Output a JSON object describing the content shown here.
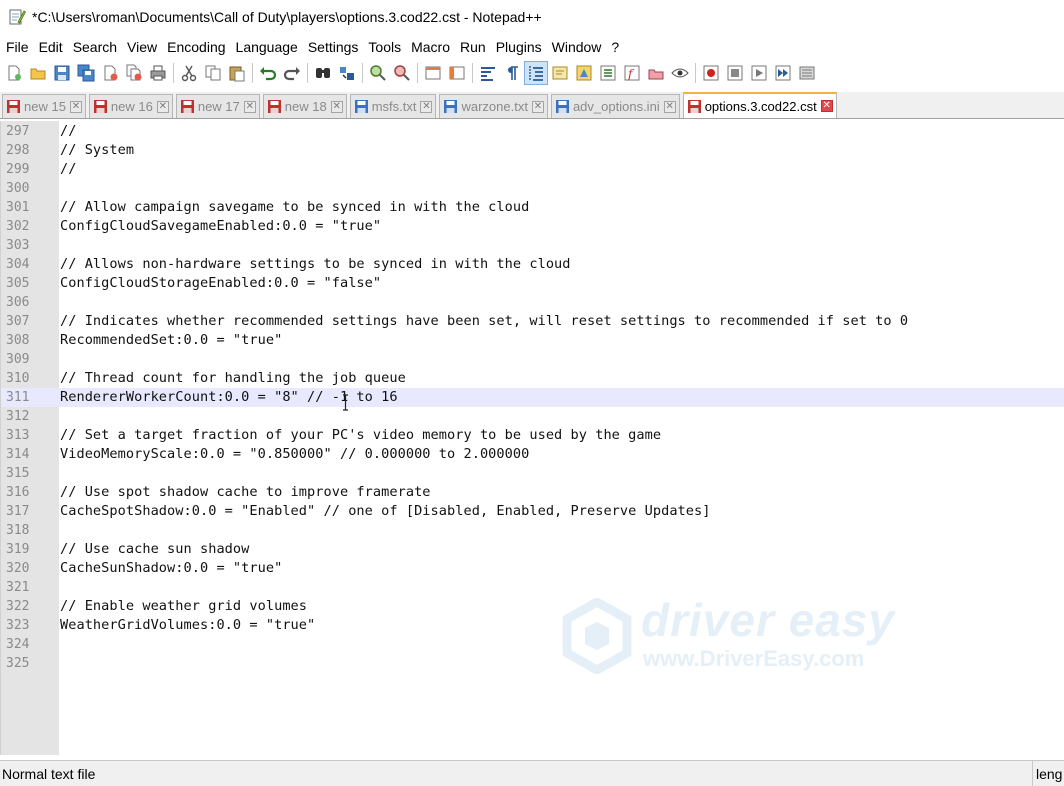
{
  "window": {
    "title": "*C:\\Users\\roman\\Documents\\Call of Duty\\players\\options.3.cod22.cst - Notepad++",
    "app_icon": "notepadpp-icon"
  },
  "menu": [
    "File",
    "Edit",
    "Search",
    "View",
    "Encoding",
    "Language",
    "Settings",
    "Tools",
    "Macro",
    "Run",
    "Plugins",
    "Window",
    "?"
  ],
  "toolbar": {
    "icons": [
      "new-file-icon",
      "open-file-icon",
      "save-icon",
      "save-all-icon",
      "close-icon",
      "close-all-icon",
      "print-icon",
      "cut-icon",
      "copy-icon",
      "paste-icon",
      "undo-icon",
      "redo-icon",
      "find-icon",
      "replace-icon",
      "zoom-in-icon",
      "zoom-out-icon",
      "sync-vertical-icon",
      "sync-horizontal-icon",
      "word-wrap-icon",
      "show-all-characters-icon",
      "indent-guide-icon",
      "user-defined-language-icon",
      "document-map-icon",
      "function-list-icon",
      "folder-as-workspace-icon",
      "monitoring-icon",
      "record-macro-icon",
      "stop-record-icon",
      "play-macro-icon",
      "run-macro-multiple-icon",
      "save-macro-icon"
    ],
    "active": "indent-guide-icon"
  },
  "tabs": [
    {
      "label": "new 15",
      "active": false,
      "saved": false
    },
    {
      "label": "new 16",
      "active": false,
      "saved": false
    },
    {
      "label": "new 17",
      "active": false,
      "saved": false
    },
    {
      "label": "new 18",
      "active": false,
      "saved": false
    },
    {
      "label": "msfs.txt",
      "active": false,
      "saved": true
    },
    {
      "label": "warzone.txt",
      "active": false,
      "saved": true
    },
    {
      "label": "adv_options.ini",
      "active": false,
      "saved": true
    },
    {
      "label": "options.3.cod22.cst",
      "active": true,
      "saved": false
    }
  ],
  "editor": {
    "current_line": 311,
    "lines": [
      {
        "n": "297",
        "text": "//"
      },
      {
        "n": "298",
        "text": "// System"
      },
      {
        "n": "299",
        "text": "//"
      },
      {
        "n": "300",
        "text": ""
      },
      {
        "n": "301",
        "text": "// Allow campaign savegame to be synced in with the cloud"
      },
      {
        "n": "302",
        "text": "ConfigCloudSavegameEnabled:0.0 = \"true\""
      },
      {
        "n": "303",
        "text": ""
      },
      {
        "n": "304",
        "text": "// Allows non-hardware settings to be synced in with the cloud"
      },
      {
        "n": "305",
        "text": "ConfigCloudStorageEnabled:0.0 = \"false\""
      },
      {
        "n": "306",
        "text": ""
      },
      {
        "n": "307",
        "text": "// Indicates whether recommended settings have been set, will reset settings to recommended if set to 0"
      },
      {
        "n": "308",
        "text": "RecommendedSet:0.0 = \"true\""
      },
      {
        "n": "309",
        "text": ""
      },
      {
        "n": "310",
        "text": "// Thread count for handling the job queue"
      },
      {
        "n": "311",
        "text": "RendererWorkerCount:0.0 = \"8\" // -1 to 16"
      },
      {
        "n": "312",
        "text": ""
      },
      {
        "n": "313",
        "text": "// Set a target fraction of your PC's video memory to be used by the game"
      },
      {
        "n": "314",
        "text": "VideoMemoryScale:0.0 = \"0.850000\" // 0.000000 to 2.000000"
      },
      {
        "n": "315",
        "text": ""
      },
      {
        "n": "316",
        "text": "// Use spot shadow cache to improve framerate"
      },
      {
        "n": "317",
        "text": "CacheSpotShadow:0.0 = \"Enabled\" // one of [Disabled, Enabled, Preserve Updates]"
      },
      {
        "n": "318",
        "text": ""
      },
      {
        "n": "319",
        "text": "// Use cache sun shadow"
      },
      {
        "n": "320",
        "text": "CacheSunShadow:0.0 = \"true\""
      },
      {
        "n": "321",
        "text": ""
      },
      {
        "n": "322",
        "text": "// Enable weather grid volumes"
      },
      {
        "n": "323",
        "text": "WeatherGridVolumes:0.0 = \"true\""
      },
      {
        "n": "324",
        "text": ""
      },
      {
        "n": "325",
        "text": ""
      }
    ]
  },
  "watermark": {
    "brand": "driver easy",
    "url": "www.DriverEasy.com"
  },
  "status": {
    "file_type": "Normal text file",
    "right": "leng"
  }
}
